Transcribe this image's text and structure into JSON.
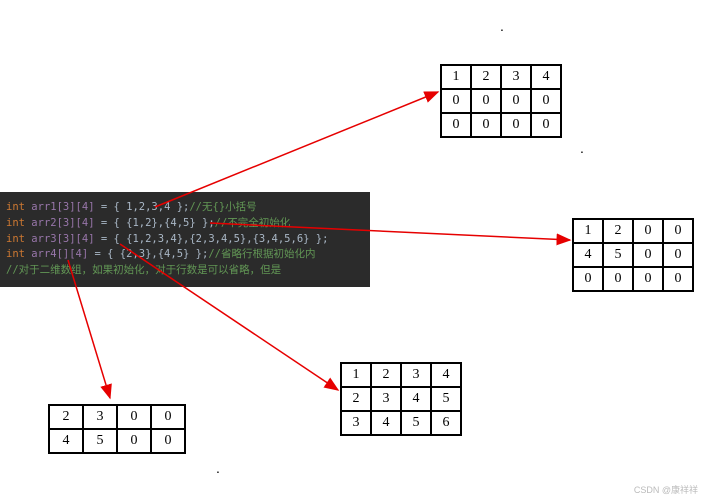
{
  "code": {
    "l1_int": "int",
    "l1_arr": "arr1",
    "l1_dim": "[3][4]",
    "l1_rest": " = { 1,2,3,4 };",
    "l1_cmt": "//无{}小括号",
    "l2_int": "int",
    "l2_arr": "arr2",
    "l2_dim": "[3][4]",
    "l2_rest": " = { {1,2},{4,5} };",
    "l2_cmt": "//不完全初始化",
    "l3_int": "int",
    "l3_arr": "arr3",
    "l3_dim": "[3][4]",
    "l3_rest": " = { {1,2,3,4},{2,3,4,5},{3,4,5,6} };",
    "l4_int": "int",
    "l4_arr": "arr4",
    "l4_dim": "[][4]",
    "l4_rest": " = { {2,3},{4,5} };",
    "l4_cmt": "//省略行根据初始化内",
    "l5_cmt": "//对于二维数组，如果初始化，对于行数是可以省略，但是"
  },
  "grids": {
    "g1": [
      [
        "1",
        "2",
        "3",
        "4"
      ],
      [
        "0",
        "0",
        "0",
        "0"
      ],
      [
        "0",
        "0",
        "0",
        "0"
      ]
    ],
    "g2": [
      [
        "1",
        "2",
        "0",
        "0"
      ],
      [
        "4",
        "5",
        "0",
        "0"
      ],
      [
        "0",
        "0",
        "0",
        "0"
      ]
    ],
    "g3": [
      [
        "1",
        "2",
        "3",
        "4"
      ],
      [
        "2",
        "3",
        "4",
        "5"
      ],
      [
        "3",
        "4",
        "5",
        "6"
      ]
    ],
    "g4": [
      [
        "2",
        "3",
        "0",
        "0"
      ],
      [
        "4",
        "5",
        "0",
        "0"
      ]
    ]
  },
  "watermark": "CSDN @康祥祥"
}
